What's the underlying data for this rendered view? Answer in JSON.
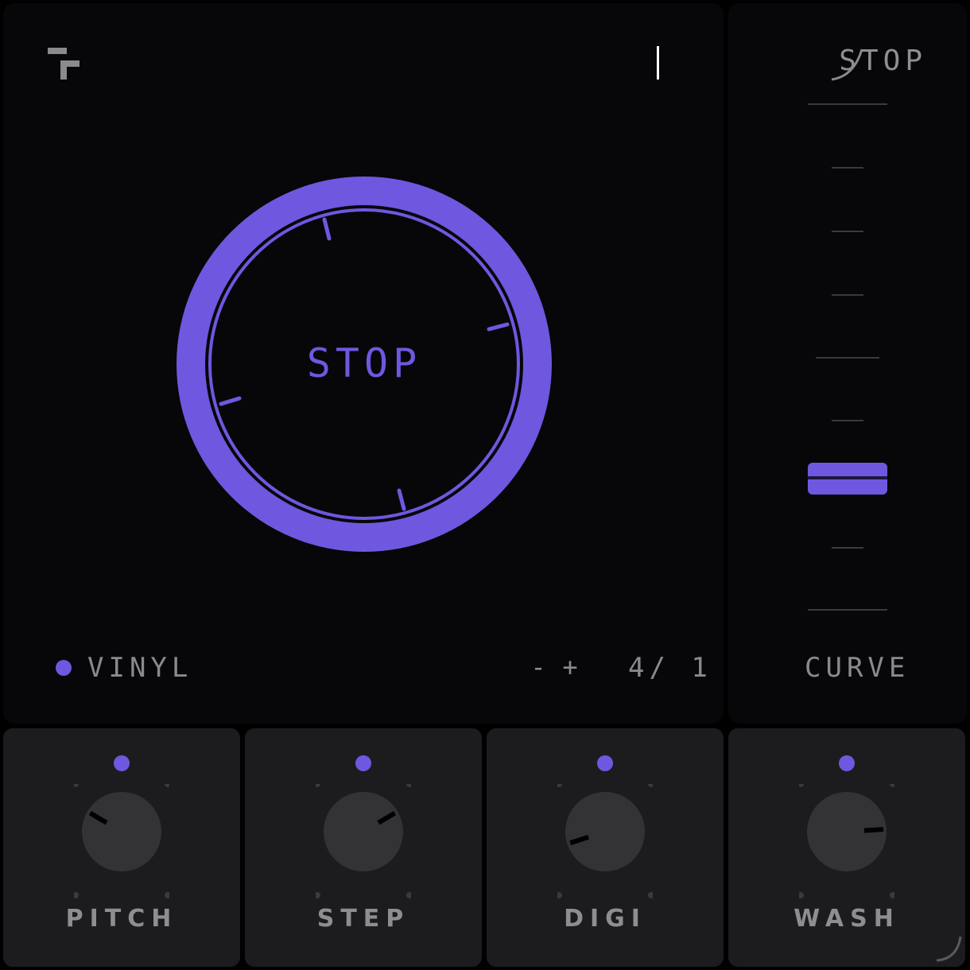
{
  "display": {
    "mode_readout": "STOP",
    "jog_label": "STOP",
    "vinyl_label": "VINYL",
    "minus_label": "-",
    "plus_label": "+",
    "ratio_readout": "4/ 1"
  },
  "fader": {
    "label": "CURVE",
    "position": 0.74
  },
  "knobs": [
    {
      "label": "PITCH",
      "value": 0.28
    },
    {
      "label": "STEP",
      "value": 0.72
    },
    {
      "label": "DIGI",
      "value": 0.1
    },
    {
      "label": "WASH",
      "value": 0.82
    }
  ],
  "colors": {
    "accent": "#7057e0",
    "panel": "#070709",
    "knob_panel": "#1c1c1e",
    "knob_body": "#333335",
    "text": "#8a8a8e"
  }
}
